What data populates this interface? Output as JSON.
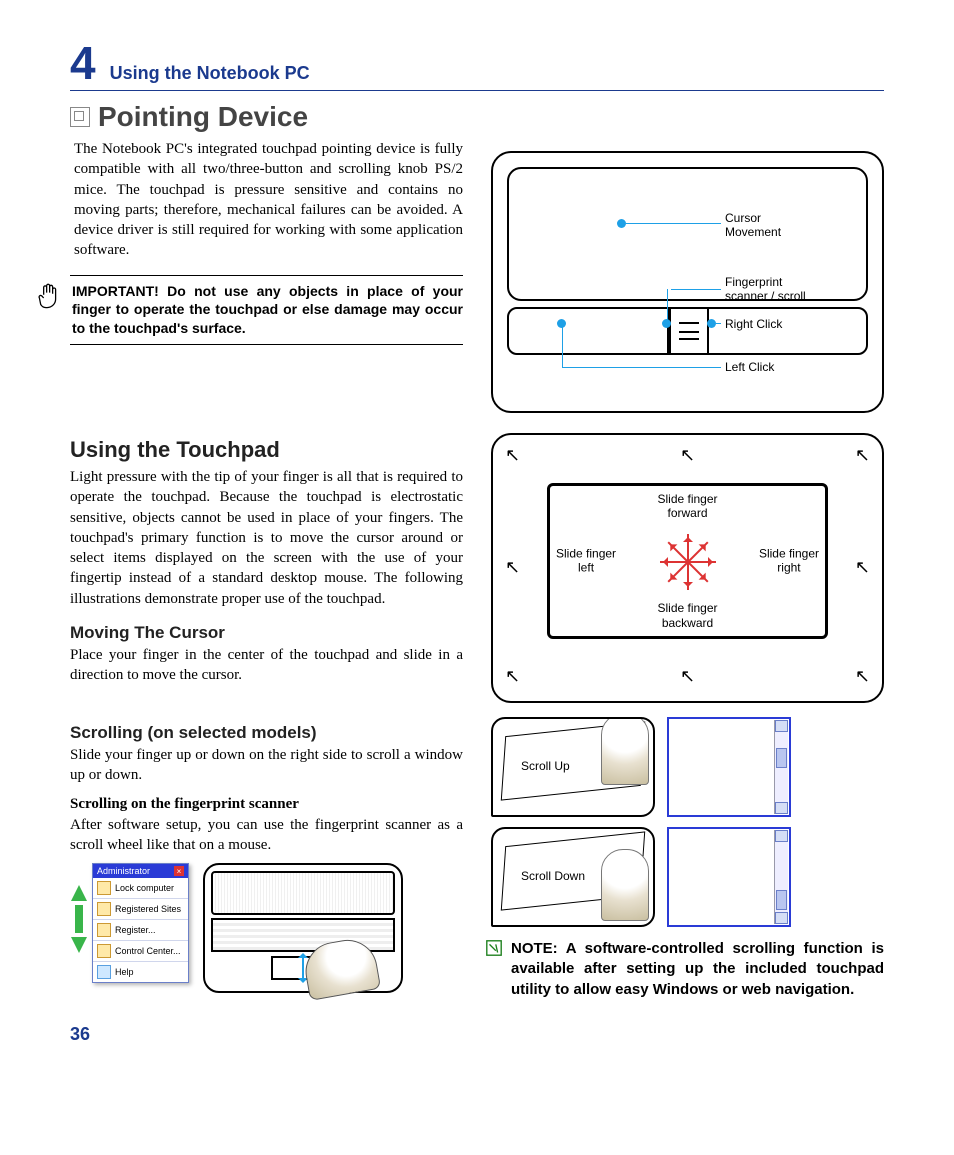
{
  "chapter": {
    "number": "4",
    "title": "Using the Notebook PC"
  },
  "h1": "Pointing Device",
  "intro": "The Notebook PC's integrated touchpad pointing device is fully compatible with all two/three-button and scrolling knob PS/2 mice. The touchpad is pressure sensitive and contains no moving parts; therefore, mechanical failures can be avoided. A device driver is still required for working with some application software.",
  "important": "IMPORTANT! Do not use any objects in place of your finger to operate the touchpad or else damage may occur to the touchpad's surface.",
  "tp_labels": {
    "cursor": "Cursor\nMovement",
    "fp": "Fingerprint\nscanner / scroll",
    "right": "Right Click",
    "left": "Left Click"
  },
  "h2_touchpad": "Using the Touchpad",
  "touchpad_body": "Light pressure with the tip of your finger is all that is required to operate the touchpad. Because the touchpad is electrostatic sensitive, objects cannot be used in place of your fingers. The touchpad's primary function is to move the cursor around or select items displayed on the screen with the use of your fingertip instead of a standard desktop mouse. The following illustrations demonstrate proper use of the touchpad.",
  "h3_moving": "Moving The Cursor",
  "moving_body": "Place your finger in the center of the touchpad and slide in a direction to move the cursor.",
  "slide": {
    "forward": "Slide finger\nforward",
    "left": "Slide finger\nleft",
    "right": "Slide finger\nright",
    "backward": "Slide finger\nbackward"
  },
  "h3_scroll": "Scrolling (on selected models)",
  "scroll_body": "Slide your finger up or down on the right side to scroll a window up or down.",
  "h4_fp": "Scrolling on the fingerprint scanner",
  "fp_body": "After software setup, you can use the fingerprint scanner as a scroll wheel like that on a mouse.",
  "scroll_labels": {
    "up": "Scroll Up",
    "down": "Scroll Down"
  },
  "fp_menu": {
    "title": "Administrator",
    "items": [
      "Lock computer",
      "Registered Sites",
      "Register...",
      "Control Center...",
      "Help"
    ]
  },
  "note": "NOTE: A software-controlled scrolling function is available after setting up the included touchpad utility to allow easy Windows or web navigation.",
  "page_number": "36"
}
